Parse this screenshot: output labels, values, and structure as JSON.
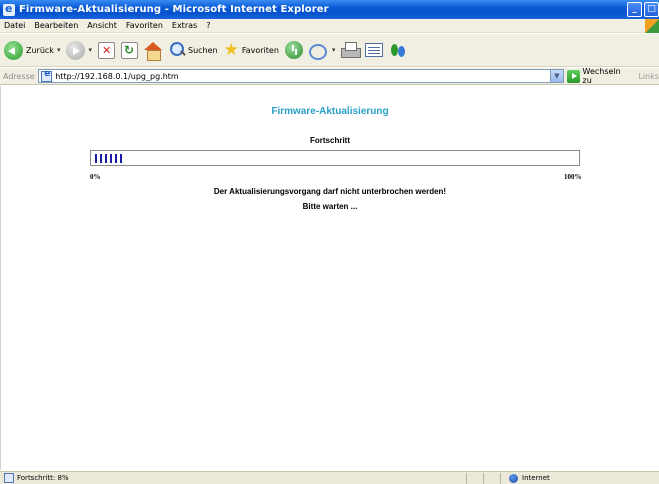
{
  "window": {
    "title": "Firmware-Aktualisierung - Microsoft Internet Explorer",
    "minimize": "_",
    "maximize": "□"
  },
  "menu": {
    "items": [
      "Datei",
      "Bearbeiten",
      "Ansicht",
      "Favoriten",
      "Extras",
      "?"
    ]
  },
  "toolbar": {
    "back_label": "Zurück",
    "search_label": "Suchen",
    "favorites_label": "Favoriten"
  },
  "addressbar": {
    "label": "Adresse",
    "url": "http://192.168.0.1/upg_pg.htm",
    "go_label": "Wechseln zu",
    "links_label": "Links"
  },
  "page": {
    "title": "Firmware-Aktualisierung",
    "progress_label": "Fortschritt",
    "progress_percent": 8,
    "progress_ticks": 6,
    "pct_start": "0%",
    "pct_end": "100%",
    "warning": "Der Aktualisierungsvorgang darf nicht unterbrochen werden!",
    "wait": "Bitte warten ..."
  },
  "status": {
    "text": "Fortschritt: 8%",
    "zone": "Internet"
  },
  "colors": {
    "title_color": "#2a9fc8",
    "progress_tick_color": "#1a1aa8"
  }
}
